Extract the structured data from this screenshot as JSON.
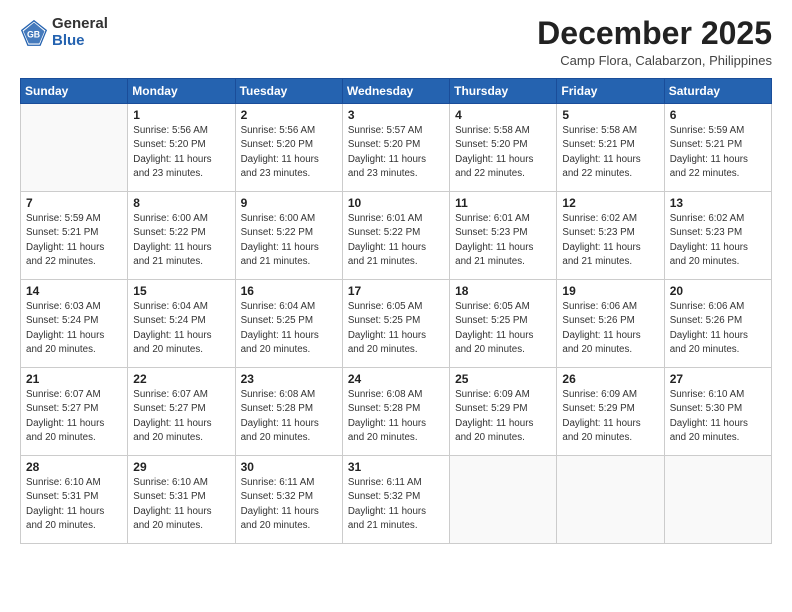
{
  "header": {
    "logo_general": "General",
    "logo_blue": "Blue",
    "month_title": "December 2025",
    "location": "Camp Flora, Calabarzon, Philippines"
  },
  "calendar": {
    "days_of_week": [
      "Sunday",
      "Monday",
      "Tuesday",
      "Wednesday",
      "Thursday",
      "Friday",
      "Saturday"
    ],
    "weeks": [
      [
        {
          "day": "",
          "info": ""
        },
        {
          "day": "1",
          "info": "Sunrise: 5:56 AM\nSunset: 5:20 PM\nDaylight: 11 hours\nand 23 minutes."
        },
        {
          "day": "2",
          "info": "Sunrise: 5:56 AM\nSunset: 5:20 PM\nDaylight: 11 hours\nand 23 minutes."
        },
        {
          "day": "3",
          "info": "Sunrise: 5:57 AM\nSunset: 5:20 PM\nDaylight: 11 hours\nand 23 minutes."
        },
        {
          "day": "4",
          "info": "Sunrise: 5:58 AM\nSunset: 5:20 PM\nDaylight: 11 hours\nand 22 minutes."
        },
        {
          "day": "5",
          "info": "Sunrise: 5:58 AM\nSunset: 5:21 PM\nDaylight: 11 hours\nand 22 minutes."
        },
        {
          "day": "6",
          "info": "Sunrise: 5:59 AM\nSunset: 5:21 PM\nDaylight: 11 hours\nand 22 minutes."
        }
      ],
      [
        {
          "day": "7",
          "info": "Sunrise: 5:59 AM\nSunset: 5:21 PM\nDaylight: 11 hours\nand 22 minutes."
        },
        {
          "day": "8",
          "info": "Sunrise: 6:00 AM\nSunset: 5:22 PM\nDaylight: 11 hours\nand 21 minutes."
        },
        {
          "day": "9",
          "info": "Sunrise: 6:00 AM\nSunset: 5:22 PM\nDaylight: 11 hours\nand 21 minutes."
        },
        {
          "day": "10",
          "info": "Sunrise: 6:01 AM\nSunset: 5:22 PM\nDaylight: 11 hours\nand 21 minutes."
        },
        {
          "day": "11",
          "info": "Sunrise: 6:01 AM\nSunset: 5:23 PM\nDaylight: 11 hours\nand 21 minutes."
        },
        {
          "day": "12",
          "info": "Sunrise: 6:02 AM\nSunset: 5:23 PM\nDaylight: 11 hours\nand 21 minutes."
        },
        {
          "day": "13",
          "info": "Sunrise: 6:02 AM\nSunset: 5:23 PM\nDaylight: 11 hours\nand 20 minutes."
        }
      ],
      [
        {
          "day": "14",
          "info": "Sunrise: 6:03 AM\nSunset: 5:24 PM\nDaylight: 11 hours\nand 20 minutes."
        },
        {
          "day": "15",
          "info": "Sunrise: 6:04 AM\nSunset: 5:24 PM\nDaylight: 11 hours\nand 20 minutes."
        },
        {
          "day": "16",
          "info": "Sunrise: 6:04 AM\nSunset: 5:25 PM\nDaylight: 11 hours\nand 20 minutes."
        },
        {
          "day": "17",
          "info": "Sunrise: 6:05 AM\nSunset: 5:25 PM\nDaylight: 11 hours\nand 20 minutes."
        },
        {
          "day": "18",
          "info": "Sunrise: 6:05 AM\nSunset: 5:25 PM\nDaylight: 11 hours\nand 20 minutes."
        },
        {
          "day": "19",
          "info": "Sunrise: 6:06 AM\nSunset: 5:26 PM\nDaylight: 11 hours\nand 20 minutes."
        },
        {
          "day": "20",
          "info": "Sunrise: 6:06 AM\nSunset: 5:26 PM\nDaylight: 11 hours\nand 20 minutes."
        }
      ],
      [
        {
          "day": "21",
          "info": "Sunrise: 6:07 AM\nSunset: 5:27 PM\nDaylight: 11 hours\nand 20 minutes."
        },
        {
          "day": "22",
          "info": "Sunrise: 6:07 AM\nSunset: 5:27 PM\nDaylight: 11 hours\nand 20 minutes."
        },
        {
          "day": "23",
          "info": "Sunrise: 6:08 AM\nSunset: 5:28 PM\nDaylight: 11 hours\nand 20 minutes."
        },
        {
          "day": "24",
          "info": "Sunrise: 6:08 AM\nSunset: 5:28 PM\nDaylight: 11 hours\nand 20 minutes."
        },
        {
          "day": "25",
          "info": "Sunrise: 6:09 AM\nSunset: 5:29 PM\nDaylight: 11 hours\nand 20 minutes."
        },
        {
          "day": "26",
          "info": "Sunrise: 6:09 AM\nSunset: 5:29 PM\nDaylight: 11 hours\nand 20 minutes."
        },
        {
          "day": "27",
          "info": "Sunrise: 6:10 AM\nSunset: 5:30 PM\nDaylight: 11 hours\nand 20 minutes."
        }
      ],
      [
        {
          "day": "28",
          "info": "Sunrise: 6:10 AM\nSunset: 5:31 PM\nDaylight: 11 hours\nand 20 minutes."
        },
        {
          "day": "29",
          "info": "Sunrise: 6:10 AM\nSunset: 5:31 PM\nDaylight: 11 hours\nand 20 minutes."
        },
        {
          "day": "30",
          "info": "Sunrise: 6:11 AM\nSunset: 5:32 PM\nDaylight: 11 hours\nand 20 minutes."
        },
        {
          "day": "31",
          "info": "Sunrise: 6:11 AM\nSunset: 5:32 PM\nDaylight: 11 hours\nand 21 minutes."
        },
        {
          "day": "",
          "info": ""
        },
        {
          "day": "",
          "info": ""
        },
        {
          "day": "",
          "info": ""
        }
      ]
    ]
  }
}
